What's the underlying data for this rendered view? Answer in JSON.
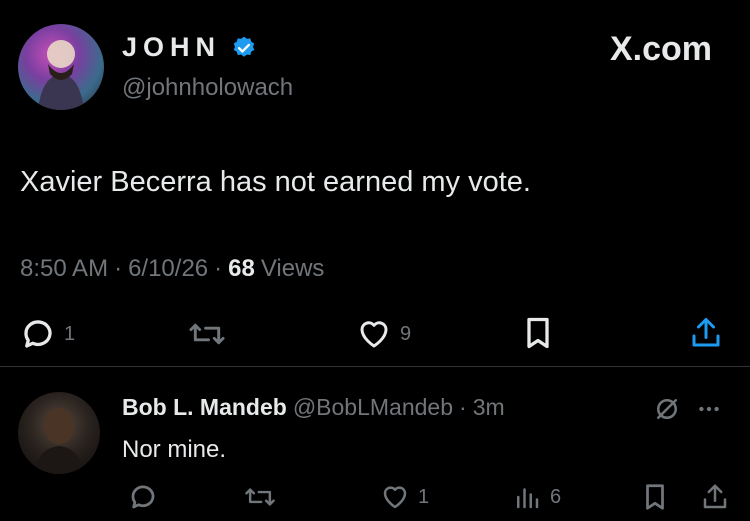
{
  "tweet": {
    "author_name": "JOHN",
    "author_handle": "@johnholowach",
    "brand": "X.com",
    "text": "Xavier Becerra has not earned my vote.",
    "time": "8:50 AM",
    "date": "6/10/26",
    "views_count": "68",
    "views_label": "Views",
    "separator": "·",
    "actions": {
      "reply_count": "1",
      "retweet_count": "",
      "like_count": "9"
    }
  },
  "reply": {
    "author_name": "Bob L. Mandeb",
    "author_handle": "@BobLMandeb",
    "time": "3m",
    "separator": "·",
    "text": "Nor mine.",
    "actions": {
      "like_count": "1",
      "views_count": "6"
    }
  },
  "colors": {
    "background": "#000000",
    "text": "#e7e9ea",
    "muted": "#71767b",
    "verified": "#1d9bf0"
  }
}
